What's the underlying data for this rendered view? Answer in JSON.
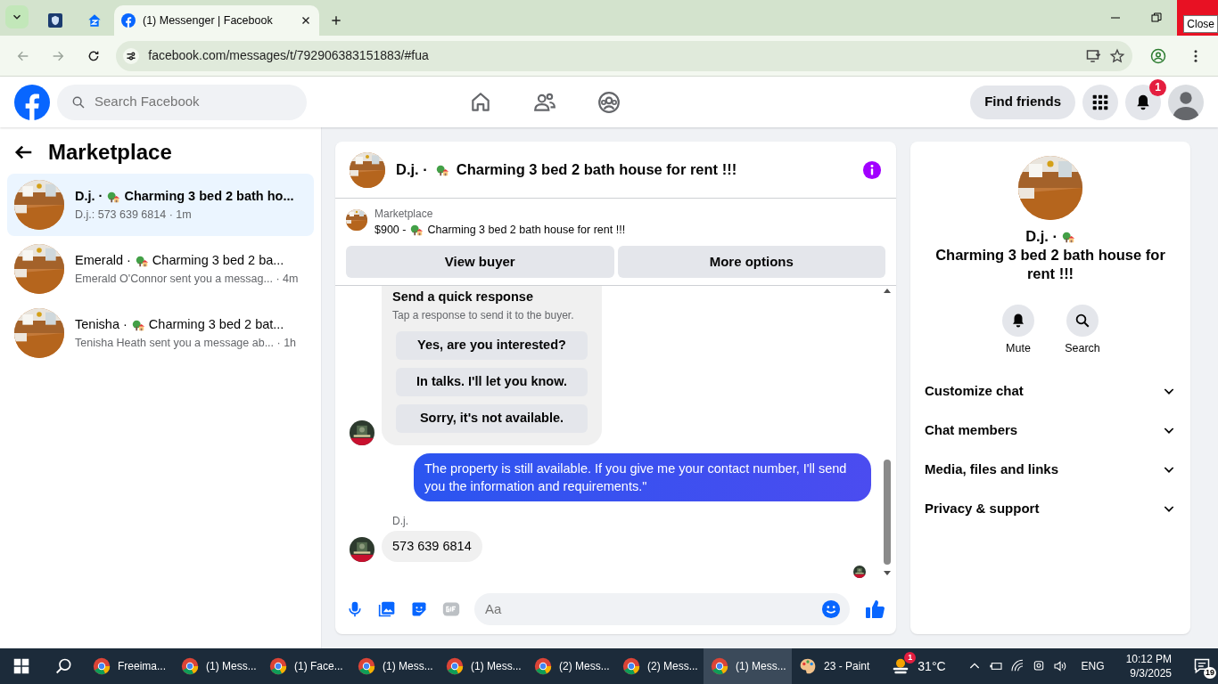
{
  "browser": {
    "tabs": [
      {
        "kind": "pinned",
        "selected": false
      },
      {
        "kind": "pinned2",
        "selected": false
      },
      {
        "kind": "page",
        "title": "(1) Messenger | Facebook",
        "selected": true
      }
    ],
    "url": "facebook.com/messages/t/792906383151883/#fua",
    "tooltip": "Close"
  },
  "header": {
    "search_placeholder": "Search Facebook",
    "find_friends": "Find friends",
    "notification_count": "1"
  },
  "sidebar": {
    "title": "Marketplace",
    "conversations": [
      {
        "name": "D.j. ·",
        "title": "Charming 3 bed 2 bath ho...",
        "preview": "D.j.: 573 639 6814 · 1m",
        "selected": true
      },
      {
        "name": "Emerald ·",
        "title": "Charming 3 bed 2 ba...",
        "preview": "Emerald O'Connor sent you a messag... · 4m",
        "selected": false
      },
      {
        "name": "Tenisha ·",
        "title": "Charming 3 bed 2 bat...",
        "preview": "Tenisha Heath sent you a message ab... · 1h",
        "selected": false
      }
    ]
  },
  "chat": {
    "name": "D.j. ·",
    "title": "Charming 3 bed 2 bath house for rent !!!",
    "listing": {
      "label": "Marketplace",
      "price": "$900 -",
      "title": "Charming 3 bed 2 bath house for rent !!!"
    },
    "buttons": [
      "View buyer",
      "More options"
    ],
    "quick_response": {
      "title": "Send a quick response",
      "subtitle": "Tap a response to send it to the buyer.",
      "options": [
        "Yes, are you interested?",
        "In talks. I'll let you know.",
        "Sorry, it's not available."
      ]
    },
    "messages": [
      {
        "kind": "outgoing",
        "text": "The property is still available. If you give me your contact number, I'll send you the information and requirements.\""
      },
      {
        "kind": "incoming",
        "sender": "D.j.",
        "text": "573 639 6814"
      }
    ],
    "composer_placeholder": "Aa"
  },
  "details": {
    "name": "D.j. ·",
    "title": "Charming 3 bed 2 bath house for rent !!!",
    "actions": [
      "Mute",
      "Search"
    ],
    "sections": [
      "Customize chat",
      "Chat members",
      "Media, files and links",
      "Privacy & support"
    ]
  },
  "taskbar": {
    "apps": [
      {
        "label": "Freeima...",
        "selected": false
      },
      {
        "label": "(1) Mess...",
        "selected": false
      },
      {
        "label": "(1) Face...",
        "selected": false
      },
      {
        "label": "(1) Mess...",
        "selected": false
      },
      {
        "label": "(1) Mess...",
        "selected": false
      },
      {
        "label": "(2) Mess...",
        "selected": false
      },
      {
        "label": "(2) Mess...",
        "selected": false
      },
      {
        "label": "(1) Mess...",
        "selected": true
      },
      {
        "label": "23 - Paint",
        "selected": false,
        "kind": "paint"
      }
    ],
    "weather_badge": "1",
    "temperature": "31°C",
    "language": "ENG",
    "time": "10:12 PM",
    "date": "9/3/2025",
    "notifications": "19"
  }
}
